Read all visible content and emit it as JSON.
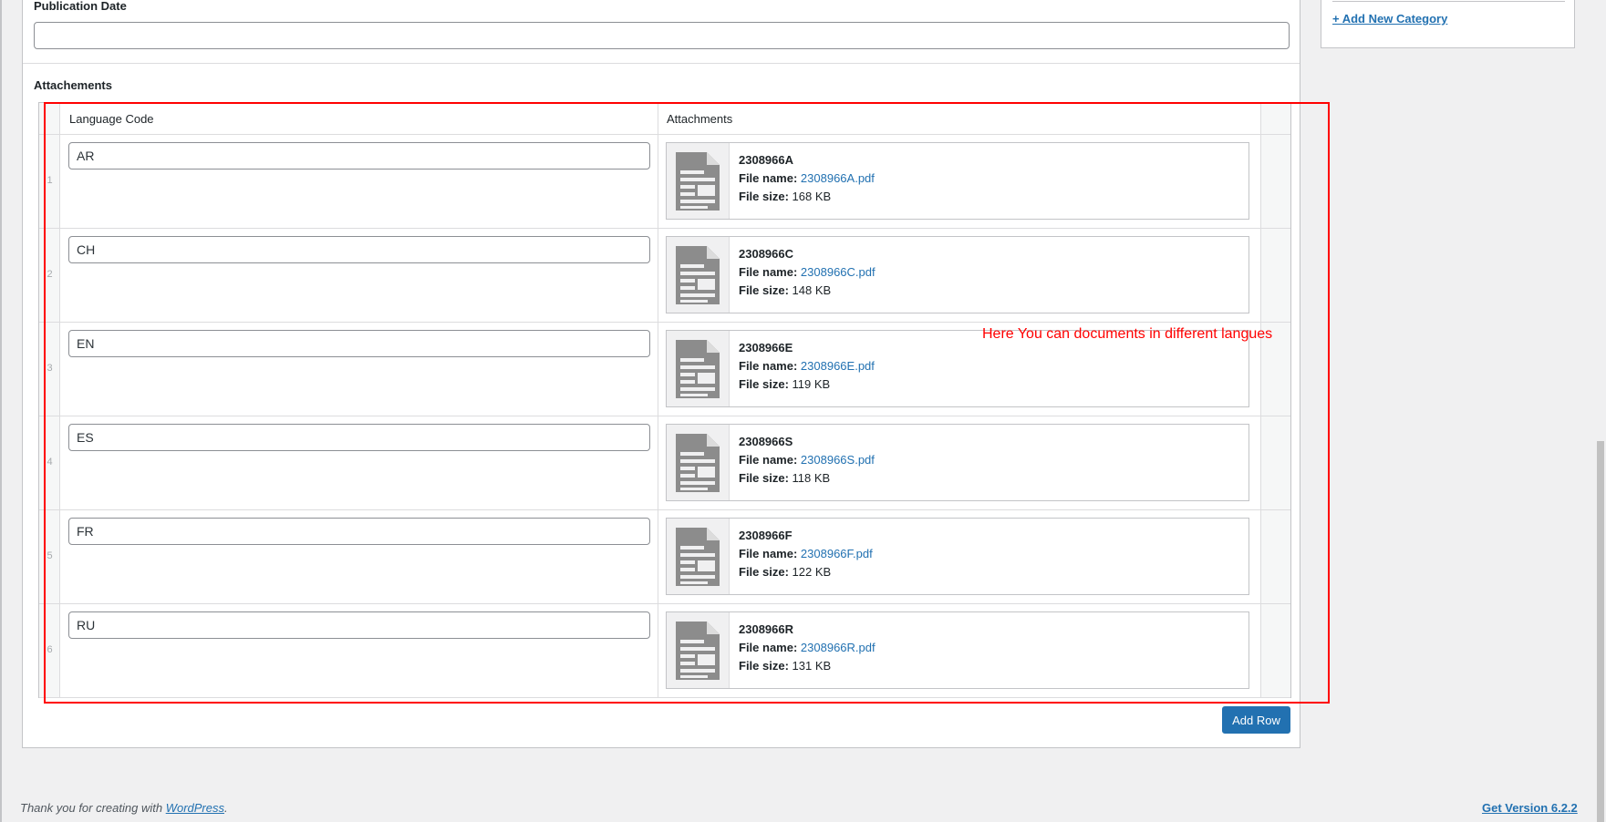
{
  "publication_date": {
    "label": "Publication Date",
    "value": ""
  },
  "attachments_section": {
    "label": "Attachements"
  },
  "table": {
    "headers": {
      "language_code": "Language Code",
      "attachments": "Attachments"
    },
    "rows": [
      {
        "num": "1",
        "lang": "AR",
        "file_title": "2308966A",
        "file_name_label": "File name:",
        "file_name": "2308966A.pdf",
        "file_size_label": "File size:",
        "file_size": "168 KB"
      },
      {
        "num": "2",
        "lang": "CH",
        "file_title": "2308966C",
        "file_name_label": "File name:",
        "file_name": "2308966C.pdf",
        "file_size_label": "File size:",
        "file_size": "148 KB"
      },
      {
        "num": "3",
        "lang": "EN",
        "file_title": "2308966E",
        "file_name_label": "File name:",
        "file_name": "2308966E.pdf",
        "file_size_label": "File size:",
        "file_size": "119 KB"
      },
      {
        "num": "4",
        "lang": "ES",
        "file_title": "2308966S",
        "file_name_label": "File name:",
        "file_name": "2308966S.pdf",
        "file_size_label": "File size:",
        "file_size": "118 KB"
      },
      {
        "num": "5",
        "lang": "FR",
        "file_title": "2308966F",
        "file_name_label": "File name:",
        "file_name": "2308966F.pdf",
        "file_size_label": "File size:",
        "file_size": "122 KB"
      },
      {
        "num": "6",
        "lang": "RU",
        "file_title": "2308966R",
        "file_name_label": "File name:",
        "file_name": "2308966R.pdf",
        "file_size_label": "File size:",
        "file_size": "131 KB"
      }
    ],
    "file_icon": "document-icon"
  },
  "annotation": {
    "text": "Here You can documents in different langues",
    "color": "#ff0000"
  },
  "add_row_button": {
    "label": "Add Row"
  },
  "sidebar": {
    "add_category_link": "+ Add New Category"
  },
  "footer": {
    "thanks_prefix": "Thank you for creating with ",
    "wordpress_link": "WordPress",
    "thanks_suffix": ".",
    "version_link": "Get Version 6.2.2"
  },
  "colors": {
    "accent": "#2271b1",
    "annotation": "#ff0000",
    "background": "#f0f0f1"
  }
}
